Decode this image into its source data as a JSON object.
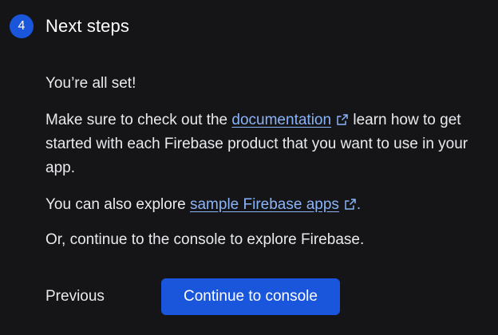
{
  "step": {
    "number": "4",
    "title": "Next steps"
  },
  "body": {
    "all_set": "You’re all set!",
    "docs_prefix": "Make sure to check out the ",
    "docs_link": "documentation",
    "docs_suffix": " learn how to get started with each Firebase product that you want to use in your app.",
    "explore_prefix": "You can also explore ",
    "explore_link": "sample Firebase apps",
    "explore_suffix": ".",
    "console_text": "Or, continue to the console to explore Firebase."
  },
  "actions": {
    "previous_label": "Previous",
    "continue_label": "Continue to console"
  },
  "icons": {
    "external_link": "open-in-new-icon"
  },
  "colors": {
    "background": "#151518",
    "accent": "#1a56db",
    "link": "#8ab4f8",
    "text": "#e8eaed"
  }
}
